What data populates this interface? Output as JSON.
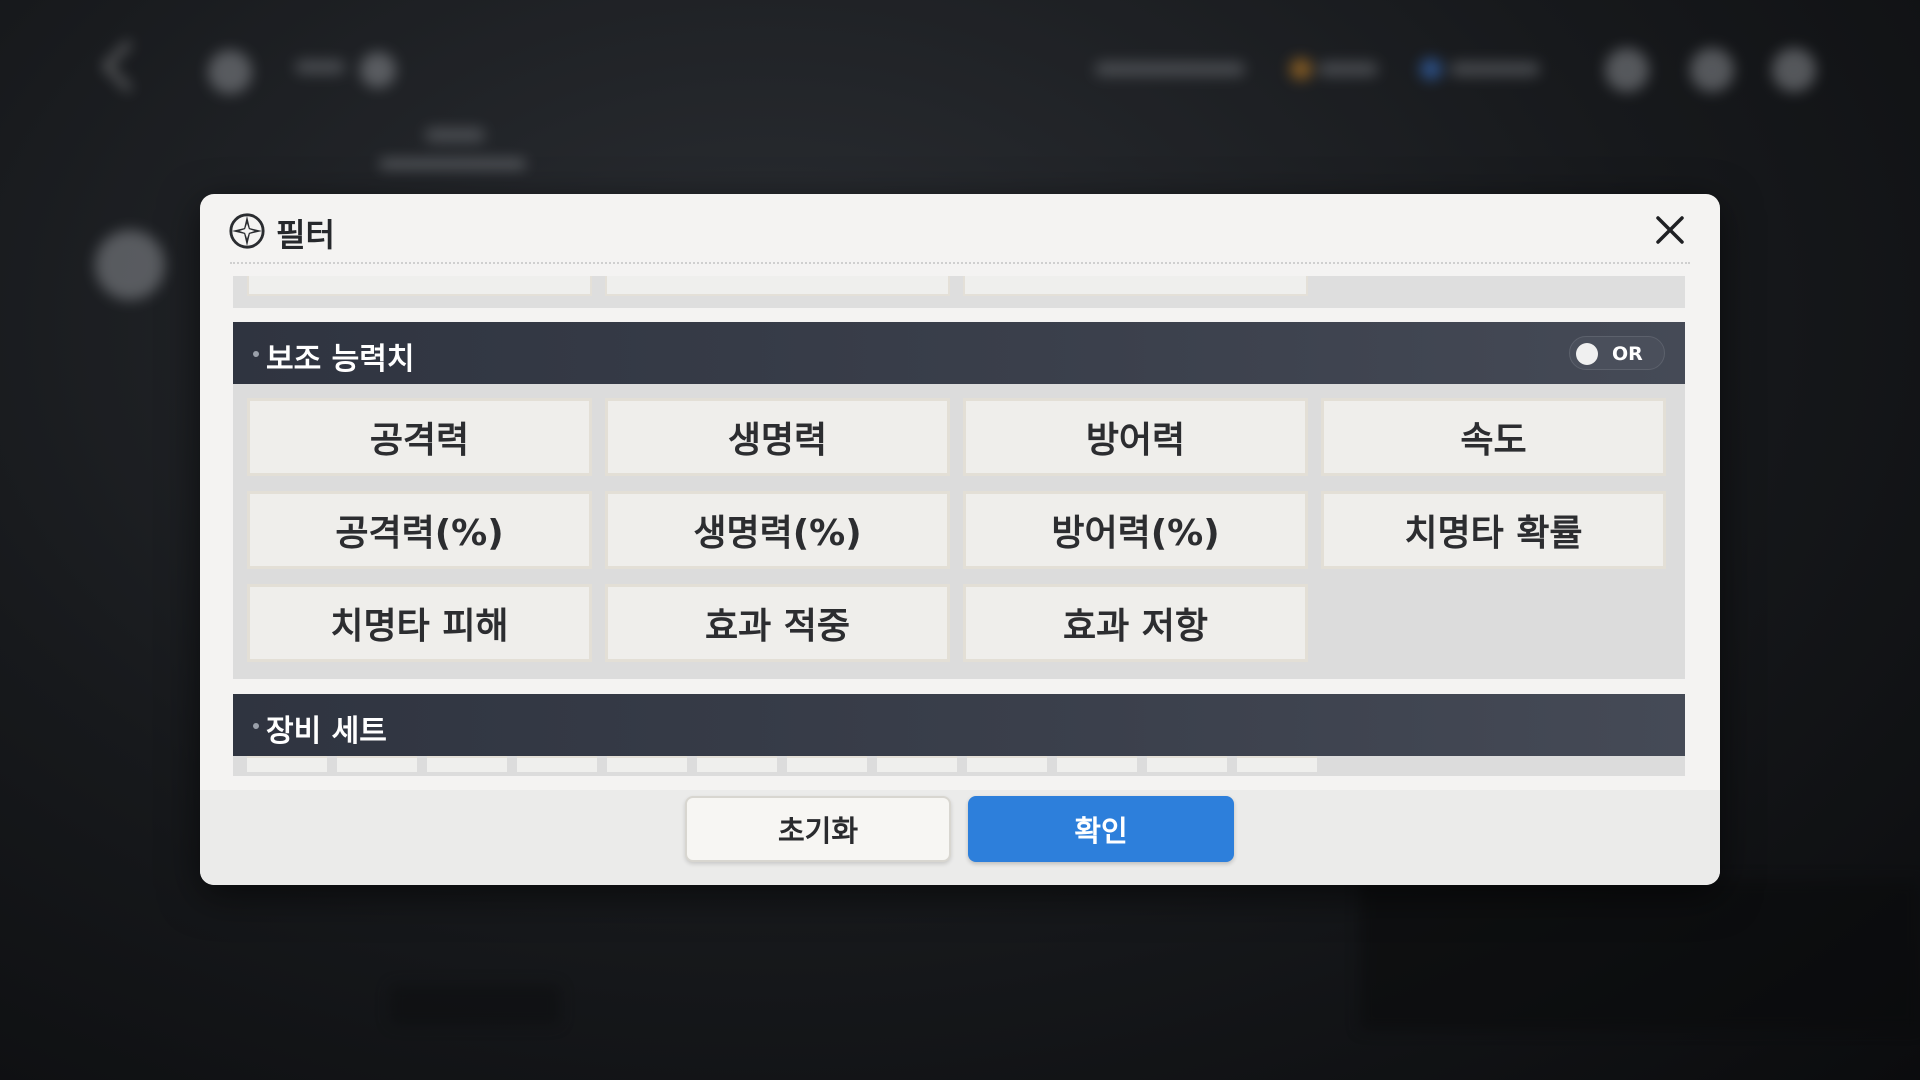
{
  "dialog": {
    "title": "필터",
    "close_icon": "close-icon",
    "logo_icon": "compass-star-icon"
  },
  "sub_stats": {
    "title": "보조 능력치",
    "toggle_label": "OR",
    "options": [
      "공격력",
      "생명력",
      "방어력",
      "속도",
      "공격력(%)",
      "생명력(%)",
      "방어력(%)",
      "치명타 확률",
      "치명타 피해",
      "효과 적중",
      "효과 저항"
    ]
  },
  "equipment_set": {
    "title": "장비 세트"
  },
  "footer": {
    "reset_label": "초기화",
    "confirm_label": "확인"
  },
  "colors": {
    "accent": "#2d7fdb",
    "section_header": "#2f3440",
    "dialog_bg": "#f4f3f2"
  }
}
